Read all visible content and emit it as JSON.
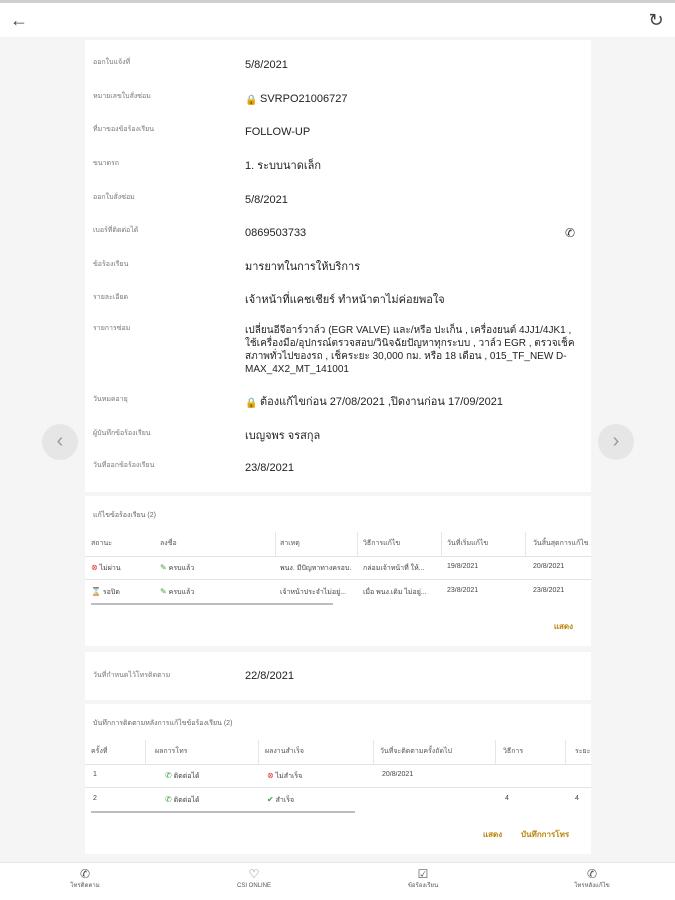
{
  "appbar": {
    "back_icon": "arrow-left-icon",
    "refresh_icon": "refresh-icon"
  },
  "details": [
    {
      "label": "ออกใบแจ้งที่",
      "value": "5/8/2021",
      "lock": false
    },
    {
      "label": "หมายเลขใบสั่งซ่อม",
      "value": "SVRPO21006727",
      "lock": true
    },
    {
      "label": "ที่มาของข้อร้องเรียน",
      "value": "FOLLOW-UP",
      "lock": false
    },
    {
      "label": "ขนาดรถ",
      "value": "1. ระบบนาดเล็ก",
      "lock": false
    },
    {
      "label": "ออกใบสั่งซ่อม",
      "value": "5/8/2021",
      "lock": false
    },
    {
      "label": "เบอร์ที่ติดต่อได้",
      "value": "0869503733",
      "lock": false,
      "phone": true
    },
    {
      "label": "ข้อร้องเรียน",
      "value": "มารยาทในการให้บริการ",
      "lock": false
    },
    {
      "label": "รายละเอียด",
      "value": "เจ้าหน้าที่แคชเชียร์ ทำหน้าตาไม่ค่อยพอใจ",
      "lock": false
    },
    {
      "label": "รายการซ่อม",
      "value": "เปลี่ยนอีจีอาร์วาล์ว (EGR VALVE) และ/หรือ ปะเก็น , เครื่องยนต์ 4JJ1/4JK1 , ใช้เครื่องมือ/อุปกรณ์ตรวจสอบ/วินิจฉัยปัญหาทุกระบบ , วาล์ว EGR , ตรวจเช็คสภาพทั่วไปของรถ , เช็คระยะ 30,000 กม. หรือ 18 เดือน , 015_TF_NEW D-MAX_4X2_MT_141001",
      "lock": false
    },
    {
      "label": "วันหมดอายุ",
      "value": "ต้องแก้ไขก่อน 27/08/2021 ,ปิดงานก่อน 17/09/2021",
      "lock": true
    },
    {
      "label": "ผู้บันทึกข้อร้องเรียน",
      "value": "เบญจพร จรสกุล",
      "lock": false
    },
    {
      "label": "วันที่ออกข้อร้องเรียน",
      "value": "23/8/2021",
      "lock": false
    }
  ],
  "nav": {
    "left_icon": "chevron-left-icon",
    "right_icon": "chevron-right-icon",
    "left": "‹",
    "right": "›"
  },
  "fixes": {
    "title": "แก้ไขข้อร้องเรียน (2)",
    "headers": [
      "สถานะ",
      "ลงชื่อ",
      "สาเหตุ",
      "วิธีการแก้ไข",
      "วันที่เริ่มแก้ไข",
      "วันสิ้นสุดการแก้ไข"
    ],
    "rows": [
      {
        "status": "ไม่ผ่าน",
        "status_icon": "x-circle-icon",
        "sign": "ครบแล้ว",
        "cause": "พนง. มีปัญหาทางครอบ...",
        "method": "กล่อมเจ้าหน้าที่ ให้...",
        "start": "19/8/2021",
        "end": "20/8/2021"
      },
      {
        "status": "รอปิด",
        "status_icon": "hourglass-icon",
        "sign": "ครบแล้ว",
        "cause": "เจ้าหน้าประจำไม่อยู่...",
        "method": "เมื่อ พนง.เดิม ไม่อยู่...",
        "start": "23/8/2021",
        "end": "23/8/2021"
      }
    ],
    "more": "แสดง"
  },
  "follow_date": {
    "label": "วันที่กำหนดไว้โทรติดตาม",
    "value": "22/8/2021"
  },
  "calls": {
    "title": "บันทึกการติดตามหลังการแก้ไขข้อร้องเรียน (2)",
    "headers": [
      "ครั้งที่",
      "ผลการโทร",
      "ผลงานสำเร็จ",
      "วันที่จะติดตามครั้งถัดไป",
      "วิธีการ",
      "ระยะ"
    ],
    "rows": [
      {
        "no": "1",
        "call": "ติดต่อได้",
        "result": "ไม่สำเร็จ",
        "result_icon": "x-circle-icon",
        "next": "20/8/2021",
        "method": "",
        "term": ""
      },
      {
        "no": "2",
        "call": "ติดต่อได้",
        "result": "สำเร็จ",
        "result_icon": "check-circle-icon",
        "next": "",
        "method": "4",
        "term": "4"
      }
    ],
    "more": "แสดง",
    "record": "บันทึกการโทร"
  },
  "bottom_nav": [
    {
      "label": "โทรติดตาม",
      "icon": "phone-call-icon"
    },
    {
      "label": "CSI ONLINE",
      "icon": "heart-icon"
    },
    {
      "label": "ข้อร้องเรียน",
      "icon": "complaint-icon"
    },
    {
      "label": "โทรหลังแก้ไข",
      "icon": "phone-follow-icon"
    }
  ]
}
